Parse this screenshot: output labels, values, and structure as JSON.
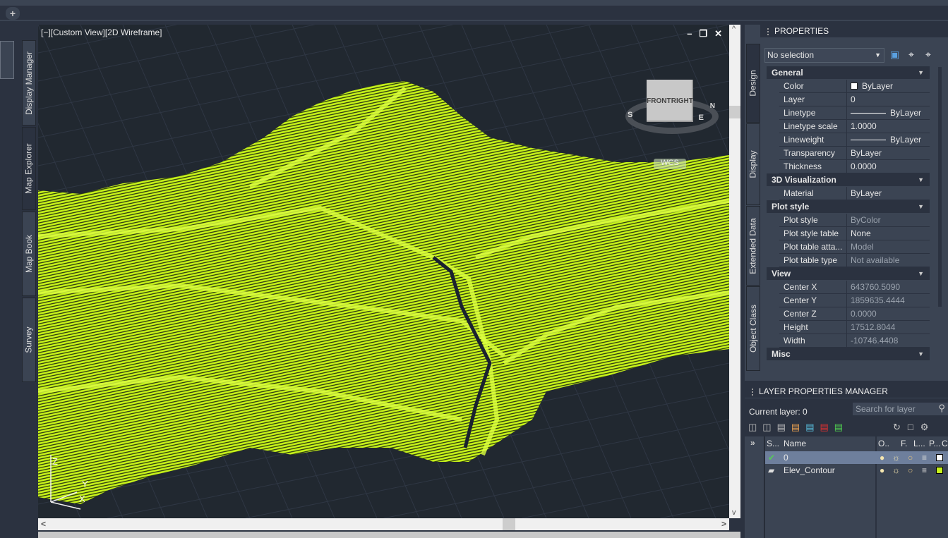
{
  "tabs": {
    "add_label": "+"
  },
  "left_tabs": [
    "Display Manager",
    "Map Explorer",
    "Map Book",
    "Survey"
  ],
  "viewport": {
    "title": "[−][Custom View][2D Wireframe]",
    "minimize": "–",
    "restore": "❐",
    "close": "✕",
    "viewcube": {
      "front": "FRONT",
      "right": "RIGHT",
      "compass": [
        "N",
        "E",
        "S"
      ]
    },
    "wcs": "WCS",
    "ucs": {
      "x": "X",
      "y": "Y",
      "z": "Z"
    },
    "terrain_color": "#c6f21a",
    "scroll_left": "<",
    "scroll_up": "^",
    "scroll_down": "v",
    "scroll_right": ">"
  },
  "properties": {
    "title": "PROPERTIES",
    "selection": "No selection",
    "side_tabs": [
      "Design",
      "Display",
      "Extended Data",
      "Object Class"
    ],
    "sections": [
      {
        "name": "General",
        "rows": [
          [
            "Color",
            "ByLayer"
          ],
          [
            "Layer",
            "0"
          ],
          [
            "Linetype",
            "ByLayer"
          ],
          [
            "Linetype scale",
            "1.0000"
          ],
          [
            "Lineweight",
            "ByLayer"
          ],
          [
            "Transparency",
            "ByLayer"
          ],
          [
            "Thickness",
            "0.0000"
          ]
        ]
      },
      {
        "name": "3D Visualization",
        "rows": [
          [
            "Material",
            "ByLayer"
          ]
        ]
      },
      {
        "name": "Plot style",
        "rows": [
          [
            "Plot style",
            "ByColor"
          ],
          [
            "Plot style table",
            "None"
          ],
          [
            "Plot table atta...",
            "Model"
          ],
          [
            "Plot table type",
            "Not available"
          ]
        ]
      },
      {
        "name": "View",
        "rows": [
          [
            "Center X",
            "643760.5090"
          ],
          [
            "Center Y",
            "1859635.4444"
          ],
          [
            "Center Z",
            "0.0000"
          ],
          [
            "Height",
            "17512.8044"
          ],
          [
            "Width",
            "-10746.4408"
          ]
        ]
      },
      {
        "name": "Misc",
        "rows": []
      }
    ]
  },
  "layers": {
    "title": "LAYER PROPERTIES MANAGER",
    "current": "Current layer: 0",
    "search_placeholder": "Search for layer",
    "columns": [
      "S...",
      "Name",
      "O..",
      "F.",
      "L...",
      "P...",
      "Co"
    ],
    "expand": "»",
    "rows": [
      {
        "name": "0",
        "color": "#ffffff",
        "current": true
      },
      {
        "name": "Elev_Contour",
        "color": "#c6f21a",
        "current": false
      }
    ]
  }
}
